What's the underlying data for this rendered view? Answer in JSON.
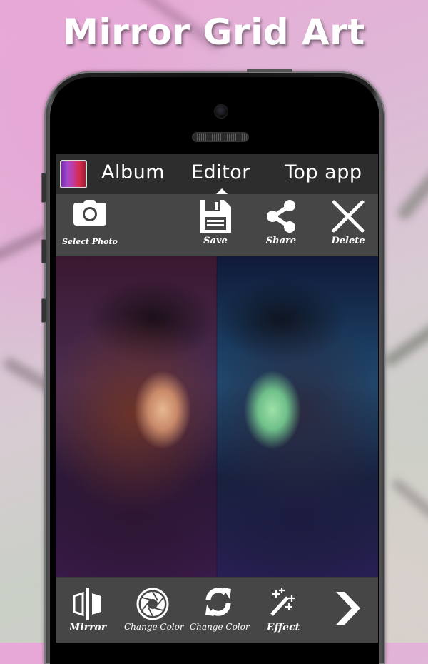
{
  "headline": "Mirror Grid Art",
  "tabs": [
    {
      "label": "Album",
      "icon": "album-thumbnail"
    },
    {
      "label": "Editor",
      "active": true
    },
    {
      "label": "Top app"
    }
  ],
  "actions": [
    {
      "label": "Select Photo",
      "icon": "camera-icon"
    },
    {
      "label": "Save",
      "icon": "floppy-disk-icon"
    },
    {
      "label": "Share",
      "icon": "share-icon"
    },
    {
      "label": "Delete",
      "icon": "close-icon"
    }
  ],
  "tools": [
    {
      "label": "Mirror",
      "icon": "mirror-icon"
    },
    {
      "label": "Change Color",
      "icon": "aperture-icon"
    },
    {
      "label": "Change Color",
      "icon": "refresh-icon"
    },
    {
      "label": "Effect",
      "icon": "magic-wand-icon"
    },
    {
      "label": "",
      "icon": "chevron-right-icon"
    }
  ],
  "colors": {
    "tabbar_bg": "#2d2d2d",
    "toolbar_bg": "#464646",
    "icon_fg": "#ffffff"
  }
}
